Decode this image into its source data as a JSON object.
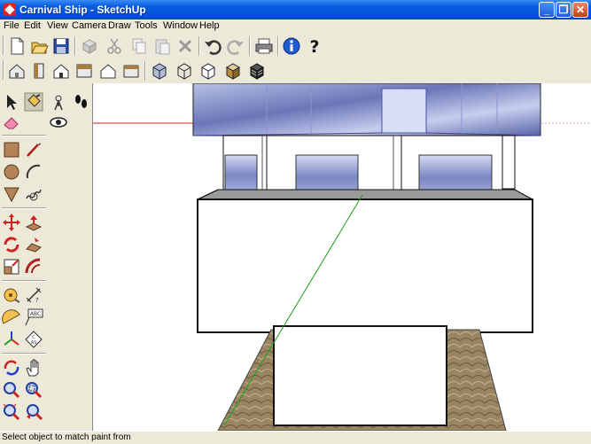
{
  "window": {
    "title": "Carnival Ship - SketchUp"
  },
  "window_controls": {
    "minimize": "_",
    "maximize": "❐",
    "close": "✕"
  },
  "menu": [
    "File",
    "Edit",
    "View",
    "Camera",
    "Draw",
    "Tools",
    "Window",
    "Help"
  ],
  "toolbar_standard": [
    "new-icon",
    "open-icon",
    "save-icon",
    "make-component-icon",
    "cut-icon",
    "copy-icon",
    "paste-icon",
    "erase-icon",
    "undo-icon",
    "redo-icon",
    "print-icon",
    "model-info-icon",
    "help-icon"
  ],
  "toolbar_views": [
    "iso-view-icon",
    "right-view-icon",
    "front-view-icon",
    "top-view-icon",
    "back-view-icon",
    "left-view-icon"
  ],
  "toolbar_styles": [
    "xray-icon",
    "wireframe-icon",
    "hidden-line-icon",
    "shaded-icon",
    "shaded-textures-icon"
  ],
  "left_tools": [
    "select-icon",
    "paint-bucket-icon",
    "make-component-icon",
    "walk-icon",
    "eraser-icon",
    "look-around-icon",
    "rectangle-icon",
    "line-icon",
    "circle-icon",
    "arc-icon",
    "polygon-icon",
    "freehand-icon",
    "move-icon",
    "push-pull-icon",
    "rotate-icon",
    "follow-me-icon",
    "scale-icon",
    "offset-icon",
    "tape-measure-icon",
    "dimension-icon",
    "protractor-icon",
    "text-icon",
    "axes-icon",
    "3d-text-icon",
    "orbit-icon",
    "pan-icon",
    "zoom-icon",
    "zoom-window-icon",
    "zoom-extents-icon",
    "previous-view-icon"
  ],
  "status": {
    "text": "Select object to match paint from"
  }
}
